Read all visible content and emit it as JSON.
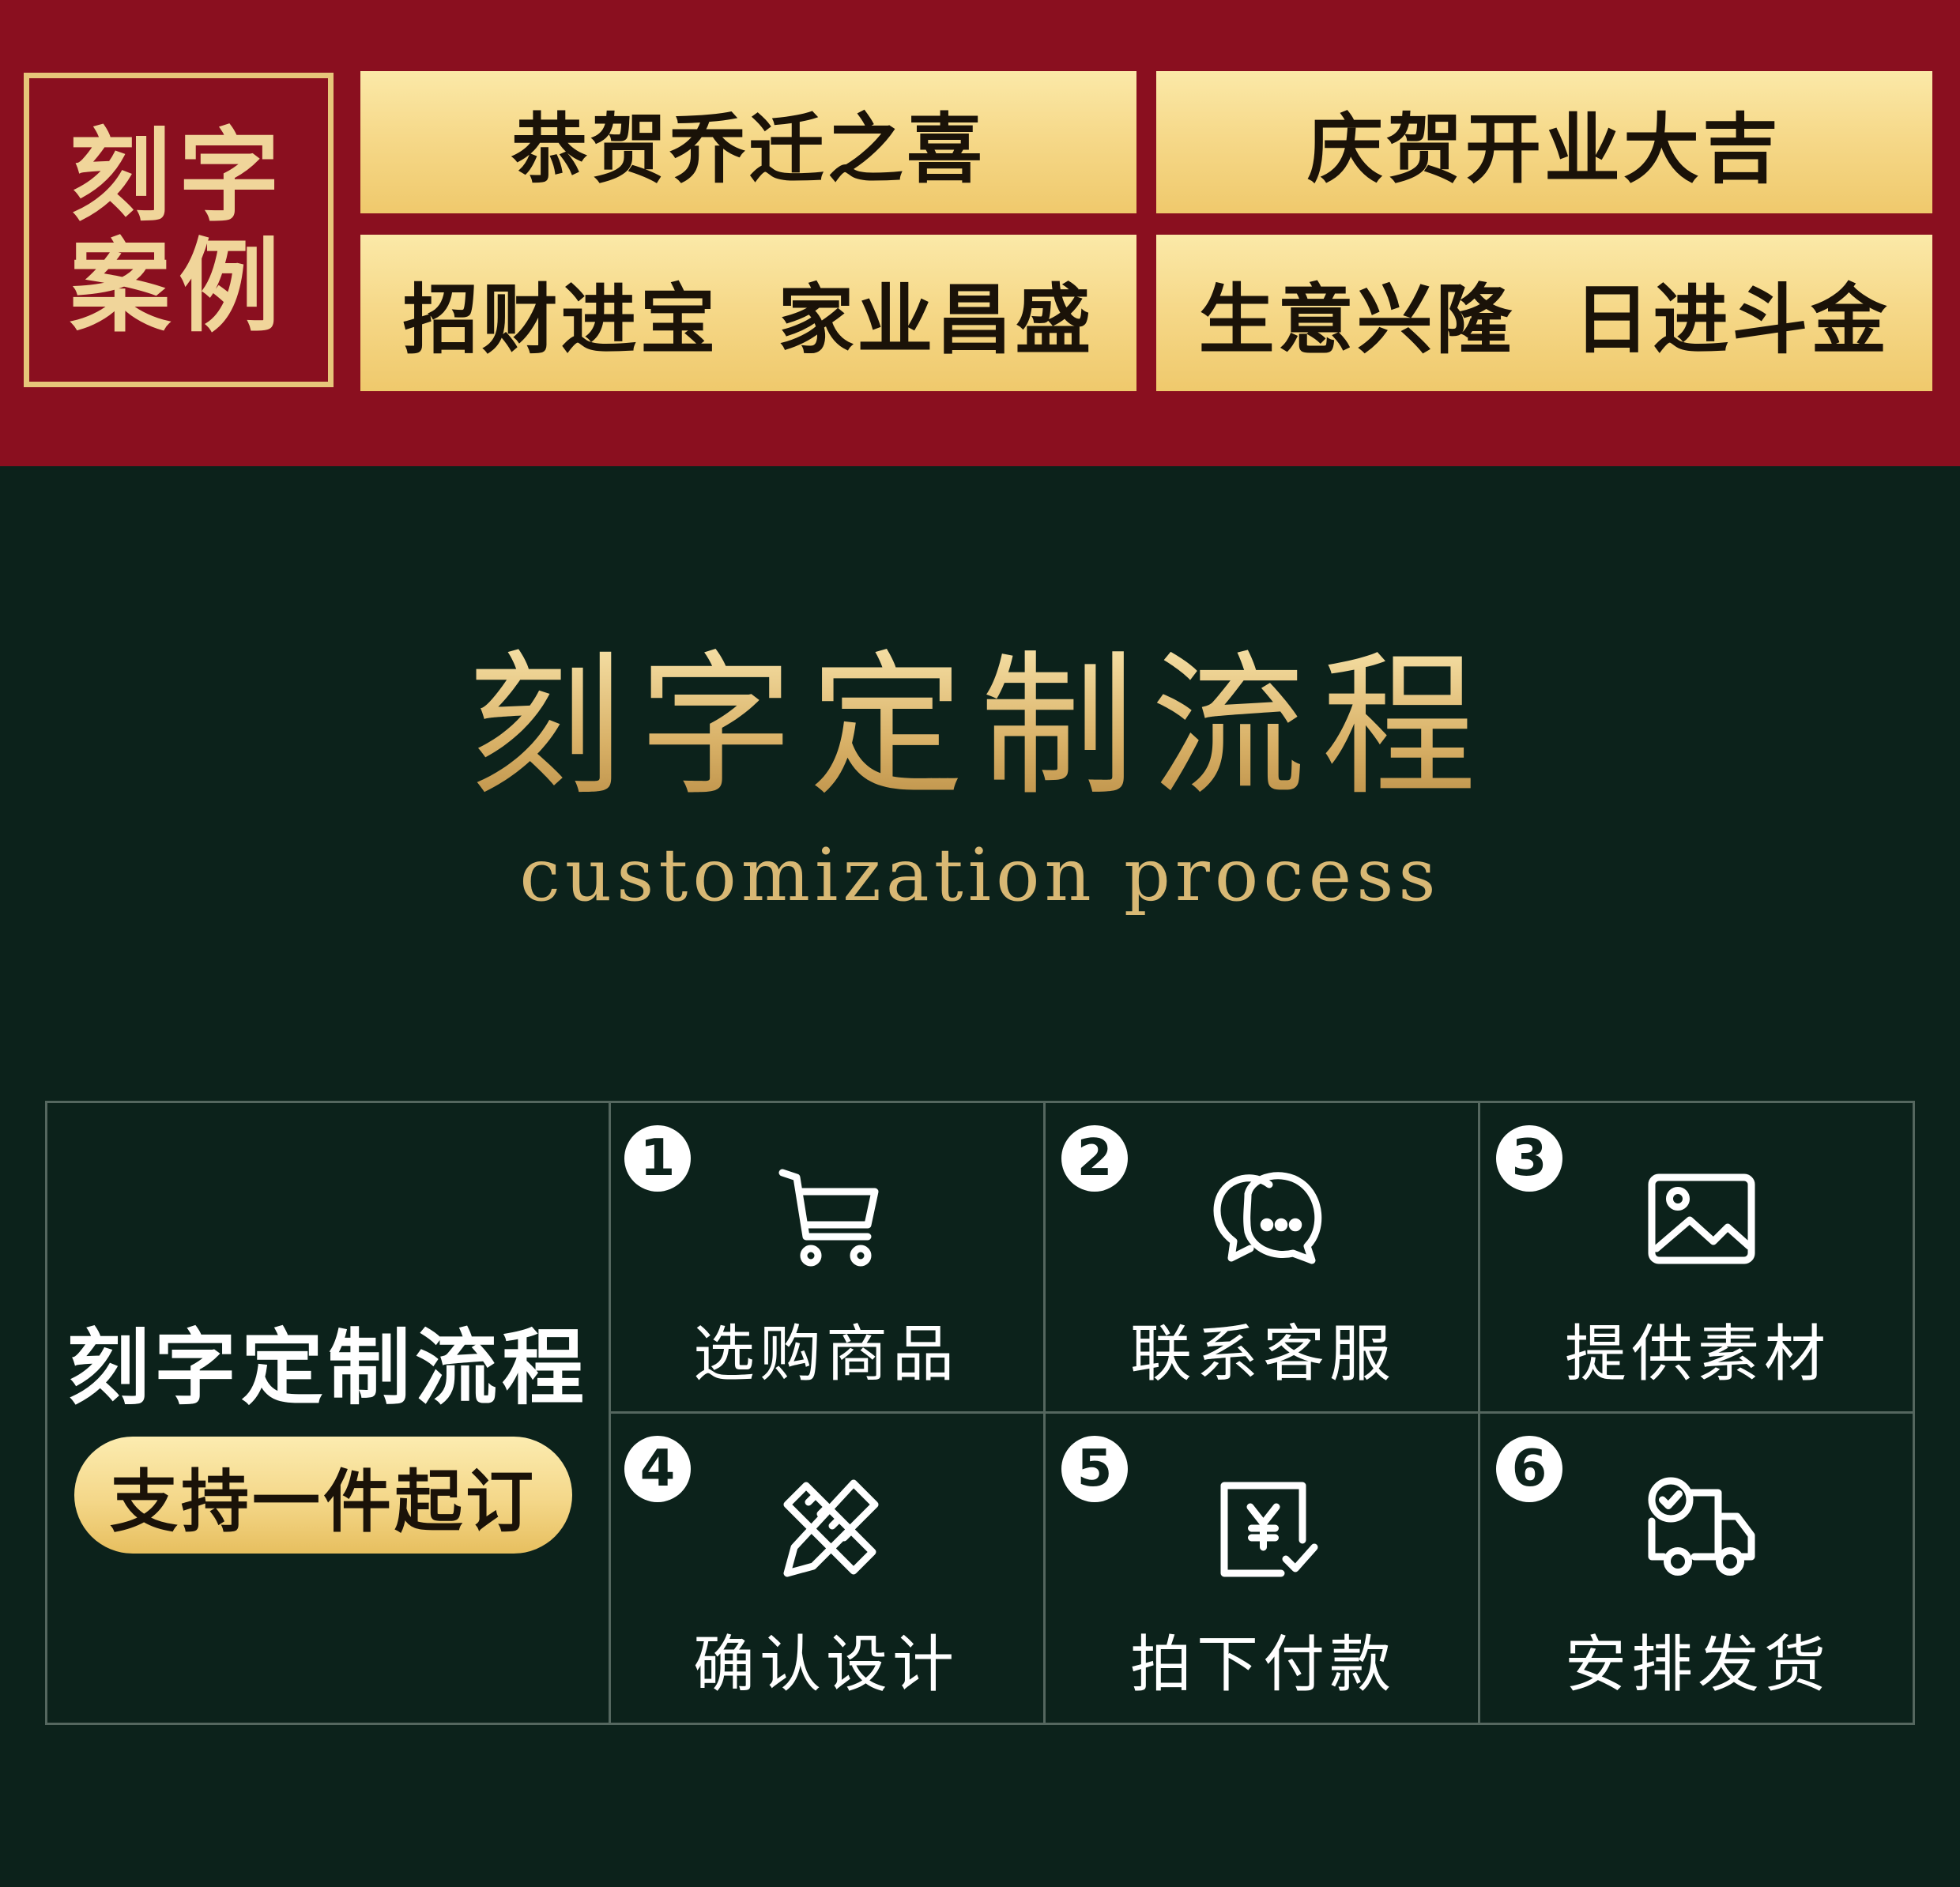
{
  "cases": {
    "box_line1": "刻字",
    "box_line2": "案例",
    "blessings": [
      "恭贺乔迁之喜",
      "庆贺开业大吉",
      "招财进宝  家业昌盛",
      "生意兴隆  日进斗金"
    ]
  },
  "header": {
    "title": "刻字定制流程",
    "subtitle": "customization process"
  },
  "process": {
    "title": "刻字定制流程",
    "badge": "支持一件起订",
    "steps": [
      {
        "number": "1",
        "label": "选购商品",
        "icon": "shopping-cart-icon"
      },
      {
        "number": "2",
        "label": "联系客服",
        "icon": "chat-bubbles-icon"
      },
      {
        "number": "3",
        "label": "提供素材",
        "icon": "image-icon"
      },
      {
        "number": "4",
        "label": "确认设计",
        "icon": "ruler-pencil-icon"
      },
      {
        "number": "5",
        "label": "拍下付款",
        "icon": "payment-icon"
      },
      {
        "number": "6",
        "label": "安排发货",
        "icon": "delivery-truck-icon"
      }
    ]
  },
  "colors": {
    "banner_red": "#8a0f1f",
    "gold": "#f4d789",
    "background_green": "#0c221b"
  }
}
